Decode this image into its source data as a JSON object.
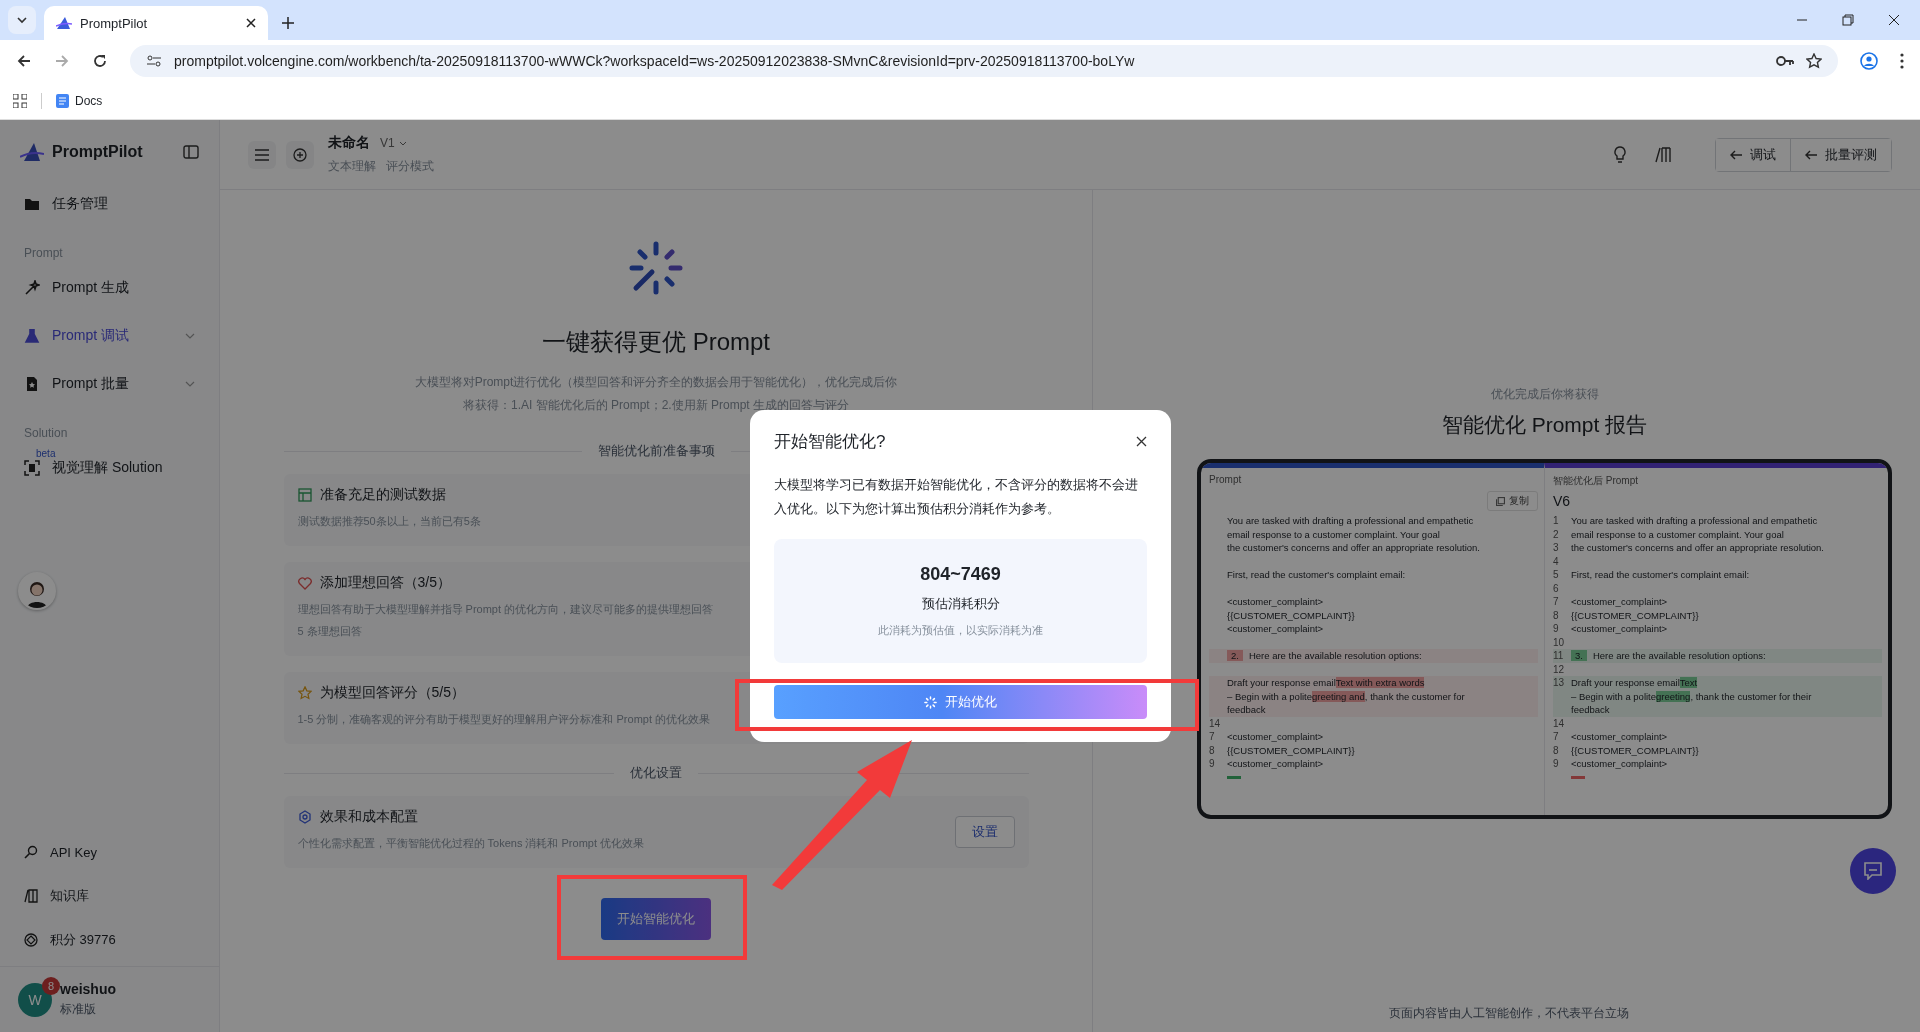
{
  "browser": {
    "tab_title": "PromptPilot",
    "url": "promptpilot.volcengine.com/workbench/ta-20250918113700-wWWCk?workspaceId=ws-20250912023838-SMvnC&revisionId=prv-20250918113700-boLYw",
    "bookmarks": [
      "Docs"
    ]
  },
  "sidebar": {
    "logo": "PromptPilot",
    "top_item": "任务管理",
    "sections": [
      {
        "heading": "Prompt",
        "items": [
          {
            "label": "Prompt 生成",
            "selected": false,
            "expandable": false
          },
          {
            "label": "Prompt 调试",
            "selected": true,
            "expandable": true
          },
          {
            "label": "Prompt 批量",
            "selected": false,
            "expandable": true
          }
        ]
      },
      {
        "heading": "Solution",
        "items": [
          {
            "label": "视觉理解 Solution",
            "selected": false,
            "expandable": false,
            "badge": "beta"
          }
        ]
      }
    ],
    "bottom_items": [
      "API Key",
      "知识库",
      "积分 39776"
    ],
    "user": {
      "initial": "W",
      "notifications": "8",
      "name": "weishuo",
      "plan": "标准版"
    }
  },
  "header": {
    "title": "未命名",
    "version": "V1",
    "tags": [
      "文本理解",
      "评分模式"
    ],
    "actions": [
      "调试",
      "批量评测"
    ]
  },
  "main": {
    "title": "一键获得更优 Prompt",
    "description": [
      "大模型将对Prompt进行优化（模型回答和评分齐全的数据会用于智能优化），优化完成后你",
      "将获得：1.AI 智能优化后的 Prompt；2.使用新 Prompt 生成的回答与评分"
    ],
    "prep_heading": "智能优化前准备事项",
    "prep_items": [
      {
        "title": "准备充足的测试数据",
        "description": [
          "测试数据推荐50条以上，当前已有5条"
        ]
      },
      {
        "title": "添加理想回答（3/5）",
        "description": [
          "理想回答有助于大模型理解并指导 Prompt 的优化方向，建议尽可能多的提供理想回答",
          "5 条理想回答"
        ]
      },
      {
        "title": "为模型回答评分（5/5）",
        "description": [
          "1-5 分制，准确客观的评分有助于模型更好的理解用户评分标准和 Prompt 的优化效果"
        ]
      }
    ],
    "settings_heading": "优化设置",
    "settings": {
      "title": "效果和成本配置",
      "description": "个性化需求配置，平衡智能优化过程的 Tokens 消耗和 Prompt 优化效果",
      "button": "设置"
    },
    "start_button": "开始智能优化"
  },
  "report": {
    "subtitle": "优化完成后你将获得",
    "title": "智能优化 Prompt 报告",
    "left": {
      "label": "Prompt",
      "copy": "复制",
      "lines": [
        {
          "kind": "plain",
          "parts": [
            {
              "kind": "plain",
              "text": "You are tasked with drafting a professional and empathetic"
            }
          ]
        },
        {
          "kind": "plain",
          "parts": [
            {
              "kind": "plain",
              "text": "email response to a customer complaint. Your goal"
            }
          ]
        },
        {
          "kind": "plain",
          "parts": [
            {
              "kind": "plain",
              "text": "the customer's concerns and offer an appropriate resolution."
            }
          ]
        },
        {
          "kind": "plain"
        },
        {
          "kind": "plain",
          "parts": [
            {
              "kind": "plain",
              "text": "First, read the customer's complaint email:"
            }
          ]
        },
        {
          "kind": "plain"
        },
        {
          "kind": "plain",
          "parts": [
            {
              "kind": "plain",
              "text": "<customer_complaint>"
            }
          ]
        },
        {
          "kind": "plain",
          "parts": [
            {
              "kind": "plain",
              "text": "{{CUSTOMER_COMPLAINT}}"
            }
          ]
        },
        {
          "kind": "plain",
          "parts": [
            {
              "kind": "plain",
              "text": "<customer_complaint>"
            }
          ]
        },
        {
          "kind": "plain"
        },
        {
          "kind": "removed",
          "parts": [
            {
              "kind": "tag",
              "text": "2."
            },
            {
              "kind": "plain",
              "text": "Here are the available resolution options:"
            }
          ]
        },
        {
          "kind": "plain"
        },
        {
          "kind": "removed",
          "parts": [
            {
              "kind": "plain",
              "text": "Draft your response email"
            },
            {
              "kind": "changed",
              "text": "Text with extra words"
            }
          ]
        },
        {
          "kind": "removed",
          "parts": [
            {
              "kind": "plain",
              "text": "– Begin with a polite"
            },
            {
              "kind": "changed",
              "text": "greeting and"
            },
            {
              "kind": "plain",
              "text": ", thank the customer for"
            }
          ]
        },
        {
          "kind": "removed",
          "parts": [
            {
              "kind": "plain",
              "text": "feedback"
            }
          ]
        },
        {
          "num": "14",
          "kind": "plain"
        },
        {
          "num": "7",
          "kind": "plain",
          "parts": [
            {
              "kind": "plain",
              "text": "<customer_complaint>"
            }
          ]
        },
        {
          "num": "8",
          "kind": "plain",
          "parts": [
            {
              "kind": "plain",
              "text": "{{CUSTOMER_COMPLAINT}}"
            }
          ]
        },
        {
          "num": "9",
          "kind": "plain",
          "parts": [
            {
              "kind": "plain",
              "text": "<customer_complaint>"
            }
          ]
        }
      ]
    },
    "right": {
      "label": "智能优化后 Prompt",
      "version": "V6",
      "lines": [
        {
          "num": "1",
          "kind": "plain",
          "parts": [
            {
              "kind": "plain",
              "text": "You are tasked with drafting a professional and empathetic"
            }
          ]
        },
        {
          "num": "2",
          "kind": "plain",
          "parts": [
            {
              "kind": "plain",
              "text": "email response to a customer complaint. Your goal"
            }
          ]
        },
        {
          "num": "3",
          "kind": "plain",
          "parts": [
            {
              "kind": "plain",
              "text": "the customer's concerns and offer an appropriate resolution."
            }
          ]
        },
        {
          "num": "4",
          "kind": "plain"
        },
        {
          "num": "5",
          "kind": "plain",
          "parts": [
            {
              "kind": "plain",
              "text": "First, read the customer's complaint email:"
            }
          ]
        },
        {
          "num": "6",
          "kind": "plain"
        },
        {
          "num": "7",
          "kind": "plain",
          "parts": [
            {
              "kind": "plain",
              "text": "<customer_complaint>"
            }
          ]
        },
        {
          "num": "8",
          "kind": "plain",
          "parts": [
            {
              "kind": "plain",
              "text": "{{CUSTOMER_COMPLAINT}}"
            }
          ]
        },
        {
          "num": "9",
          "kind": "plain",
          "parts": [
            {
              "kind": "plain",
              "text": "<customer_complaint>"
            }
          ]
        },
        {
          "num": "10",
          "kind": "plain"
        },
        {
          "num": "11",
          "kind": "added",
          "parts": [
            {
              "kind": "tag",
              "text": "3."
            },
            {
              "kind": "plain",
              "text": "Here are the available resolution options:"
            }
          ]
        },
        {
          "num": "12",
          "kind": "plain"
        },
        {
          "num": "13",
          "kind": "added",
          "parts": [
            {
              "kind": "plain",
              "text": "Draft your response email"
            },
            {
              "kind": "changed",
              "text": "Text"
            }
          ]
        },
        {
          "kind": "added",
          "parts": [
            {
              "kind": "plain",
              "text": "– Begin with a polite"
            },
            {
              "kind": "changed",
              "text": "greeting"
            },
            {
              "kind": "plain",
              "text": ", thank the customer for their"
            }
          ]
        },
        {
          "kind": "added",
          "parts": [
            {
              "kind": "plain",
              "text": "feedback"
            }
          ]
        },
        {
          "num": "14",
          "kind": "plain"
        },
        {
          "num": "7",
          "kind": "plain",
          "parts": [
            {
              "kind": "plain",
              "text": "<customer_complaint>"
            }
          ]
        },
        {
          "num": "8",
          "kind": "plain",
          "parts": [
            {
              "kind": "plain",
              "text": "{{CUSTOMER_COMPLAINT}}"
            }
          ]
        },
        {
          "num": "9",
          "kind": "plain",
          "parts": [
            {
              "kind": "plain",
              "text": "<customer_complaint>"
            }
          ]
        }
      ]
    }
  },
  "footer": "页面内容皆由人工智能创作，不代表平台立场",
  "modal": {
    "title": "开始智能优化?",
    "body": "大模型将学习已有数据开始智能优化，不含评分的数据将不会进入优化。以下为您计算出预估积分消耗作为参考。",
    "estimate": "804~7469",
    "estimate_label": "预估消耗积分",
    "note": "此消耗为预估值，以实际消耗为准",
    "button": "开始优化"
  }
}
